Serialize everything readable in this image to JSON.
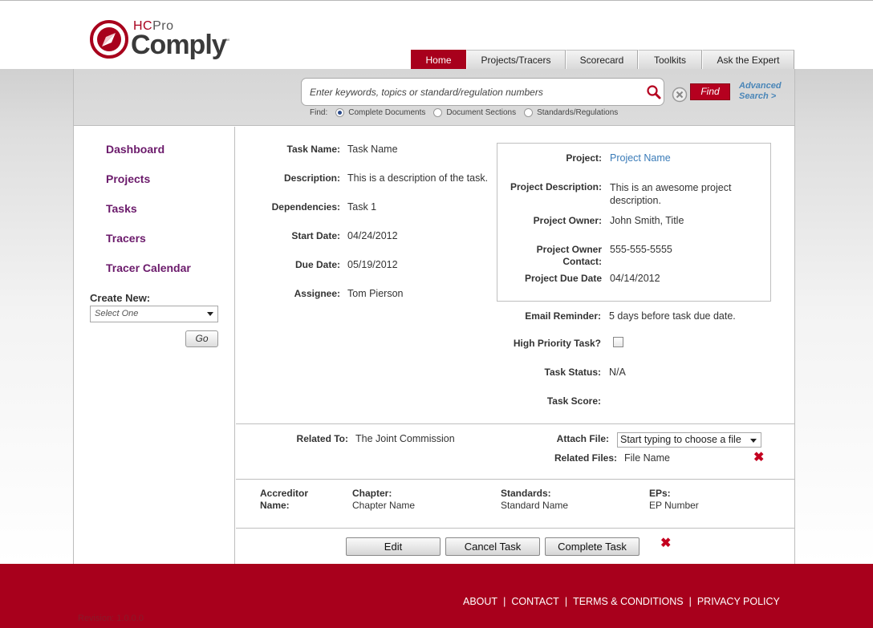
{
  "logo": {
    "brand_prefix_h": "HC",
    "brand_prefix_rest": "Pro",
    "brand_name": "Comply",
    "trademark": "™"
  },
  "nav": {
    "tabs": [
      {
        "label": "Home",
        "active": true
      },
      {
        "label": "Projects/Tracers",
        "active": false
      },
      {
        "label": "Scorecard",
        "active": false
      },
      {
        "label": "Toolkits",
        "active": false
      },
      {
        "label": "Ask the Expert",
        "active": false
      }
    ]
  },
  "search": {
    "placeholder": "Enter keywords, topics or standard/regulation numbers",
    "find_button": "Find",
    "advanced_line1": "Advanced",
    "advanced_line2": "Search >",
    "find_label": "Find:",
    "options": [
      {
        "label": "Complete Documents",
        "selected": true
      },
      {
        "label": "Document Sections",
        "selected": false
      },
      {
        "label": "Standards/Regulations",
        "selected": false
      }
    ]
  },
  "sidebar": {
    "links": [
      "Dashboard",
      "Projects",
      "Tasks",
      "Tracers",
      "Tracer Calendar"
    ],
    "create_new_label": "Create New:",
    "select_value": "Select One",
    "go_button": "Go"
  },
  "task": {
    "name_label": "Task Name:",
    "name": "Task Name",
    "description_label": "Description:",
    "description": "This is a description of the task.",
    "dependencies_label": "Dependencies:",
    "dependencies": "Task 1",
    "start_label": "Start Date:",
    "start": "04/24/2012",
    "due_label": "Due Date:",
    "due": "05/19/2012",
    "assignee_label": "Assignee:",
    "assignee": "Tom Pierson"
  },
  "project": {
    "project_label": "Project:",
    "project": "Project Name",
    "description_label": "Project Description:",
    "description_line1": "This is an awesome project",
    "description_line2": "description.",
    "owner_label": "Project Owner:",
    "owner": "John Smith, Title",
    "contact_label_line1": "Project Owner",
    "contact_label_line2": "Contact:",
    "contact": "555-555-5555",
    "due_label": "Project Due Date",
    "due": "04/14/2012"
  },
  "status": {
    "reminder_label": "Email Reminder:",
    "reminder": "5 days before task due date.",
    "priority_label": "High Priority Task?",
    "priority_checked": false,
    "status_label": "Task Status:",
    "status": "N/A",
    "score_label": "Task Score:",
    "score": ""
  },
  "related": {
    "related_to_label": "Related To:",
    "related_to": "The Joint Commission",
    "attach_label": "Attach File:",
    "attach_value": "Start typing to choose a file",
    "files_label": "Related Files:",
    "file_name": "File Name"
  },
  "accreditor": {
    "name_label_line1": "Accreditor",
    "name_label_line2": "Name:",
    "chapter_label": "Chapter:",
    "chapter": "Chapter Name",
    "standards_label": "Standards:",
    "standard": "Standard Name",
    "eps_label": "EPs:",
    "ep": "EP Number"
  },
  "actions": {
    "edit": "Edit",
    "cancel": "Cancel Task",
    "complete": "Complete Task",
    "delete_glyph": "✖"
  },
  "footer": {
    "links": [
      "ABOUT",
      "CONTACT",
      "TERMS & CONDITIONS",
      "PRIVACY POLICY"
    ],
    "separator": "|",
    "revision": "Revision: 1.0.0.0"
  },
  "colors": {
    "brand_red": "#a8001c",
    "link_purple": "#6b1a6b",
    "link_blue": "#3a7bb8"
  }
}
